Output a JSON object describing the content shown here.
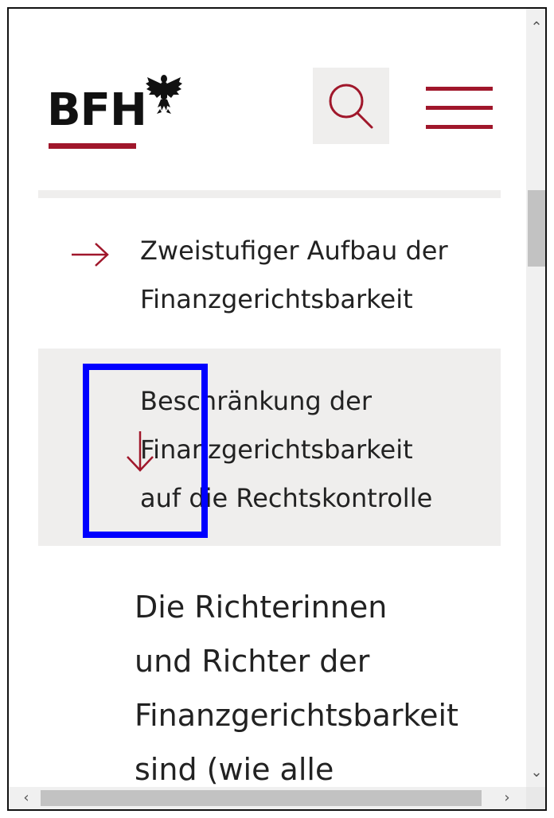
{
  "header": {
    "logo_text": "BFH",
    "logo_icon": "federal-eagle-icon",
    "search_icon": "search-icon",
    "menu_icon": "hamburger-menu-icon"
  },
  "nav": {
    "items": [
      {
        "label": "Zweistufiger Aufbau der\nFinanzgerichtsbarkeit",
        "icon": "arrow-right-icon",
        "expanded": false
      },
      {
        "label": "Beschränkung der\nFinanzgerichtsbarkeit\nauf die Rechtskontrolle",
        "icon": "arrow-down-icon",
        "expanded": true
      }
    ]
  },
  "content": {
    "text": "Die Richterinnen\nund Richter der\nFinanzgerichtsbarkeit\nsind (wie alle"
  },
  "scrollbars": {
    "up_glyph": "⌃",
    "down_glyph": "⌄",
    "left_glyph": "‹",
    "right_glyph": "›"
  },
  "colors": {
    "brand_red": "#a0172b",
    "highlight_blue": "#0000ff",
    "panel_gray": "#efeeed"
  }
}
